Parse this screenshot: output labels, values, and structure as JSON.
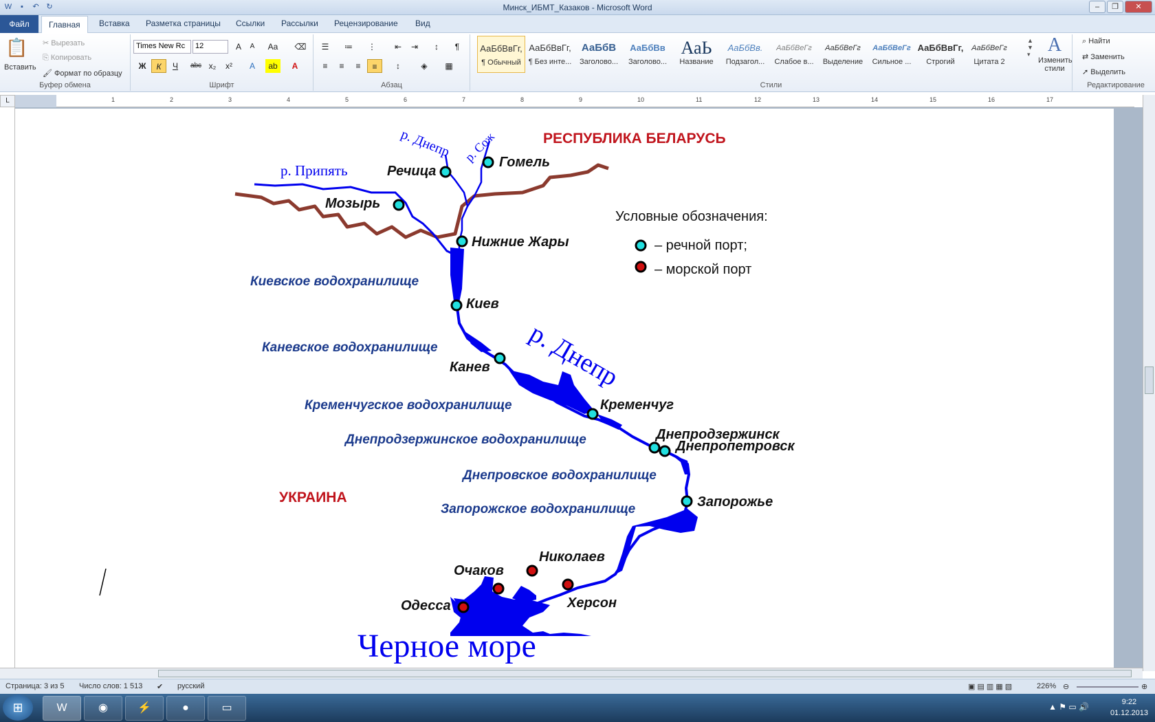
{
  "window": {
    "title": "Минск_ИБМТ_Казаков - Microsoft Word"
  },
  "tabs": [
    "Главная",
    "Вставка",
    "Разметка страницы",
    "Ссылки",
    "Рассылки",
    "Рецензирование",
    "Вид"
  ],
  "file_tab": "Файл",
  "clipboard": {
    "paste": "Вставить",
    "cut": "Вырезать",
    "copy": "Копировать",
    "format_painter": "Формат по образцу",
    "label": "Буфер обмена"
  },
  "font": {
    "name": "Times New Rc",
    "size": "12",
    "bold": "Ж",
    "italic": "К",
    "underline": "Ч",
    "strike": "abc",
    "sub": "x₂",
    "sup": "x²",
    "label": "Шрифт"
  },
  "paragraph": {
    "label": "Абзац"
  },
  "styles": {
    "label": "Стили",
    "items": [
      {
        "preview": "АаБбВвГг,",
        "name": "¶ Обычный"
      },
      {
        "preview": "АаБбВвГг,",
        "name": "¶ Без инте..."
      },
      {
        "preview": "АаБбВ",
        "name": "Заголово..."
      },
      {
        "preview": "АаБбВв",
        "name": "Заголово..."
      },
      {
        "preview": "АаЬ",
        "name": "Название"
      },
      {
        "preview": "АаБбВв.",
        "name": "Подзагол..."
      },
      {
        "preview": "АаБбВеГг",
        "name": "Слабое в..."
      },
      {
        "preview": "АаБбВеГг",
        "name": "Выделение"
      },
      {
        "preview": "АаБбВеГг",
        "name": "Сильное ..."
      },
      {
        "preview": "АаБбВвГг,",
        "name": "Строгий"
      },
      {
        "preview": "АаБбВеГг",
        "name": "Цитата 2"
      }
    ],
    "change_styles": "Изменить стили"
  },
  "editing": {
    "label": "Редактирование",
    "find": "Найти",
    "replace": "Заменить",
    "select": "Выделить"
  },
  "ruler": {
    "h": [
      "1",
      "2",
      "3",
      "4",
      "5",
      "6",
      "7",
      "8",
      "9",
      "10",
      "11",
      "12",
      "13",
      "14",
      "15",
      "16",
      "17"
    ]
  },
  "map": {
    "country_belarus": "РЕСПУБЛИКА БЕЛАРУСЬ",
    "country_ukraine": "УКРАИНА",
    "river_dnepr_top": "р. Днепр",
    "river_sozh": "р. Сож",
    "river_pripyat": "р. Припять",
    "river_dnepr_big": "р. Днепр",
    "sea": "Черное море",
    "legend_title": "Условные обозначения:",
    "legend_river": "– речной порт;",
    "legend_sea": "– морской порт",
    "river_ports": [
      "Речица",
      "Гомель",
      "Мозырь",
      "Нижние Жары",
      "Киев",
      "Канев",
      "Кременчуг",
      "Днепродзержинск",
      "Днепропетровск",
      "Запорожье"
    ],
    "sea_ports": [
      "Очаков",
      "Николаев",
      "Херсон",
      "Одесса"
    ],
    "reservoirs": [
      "Киевское водохранилище",
      "Каневское водохранилище",
      "Кременчугское водохранилище",
      "Днепродзержинское водохранилище",
      "Днепровское водохранилище",
      "Запорожское водохранилище"
    ],
    "colors": {
      "river": "#0000ee",
      "border": "#8b3a2e",
      "country": "#c0141c",
      "reservoir": "#1b3a8c",
      "river_port": "#22e0e0",
      "sea_port": "#d01010"
    }
  },
  "status": {
    "page": "Страница: 3 из 5",
    "words": "Число слов: 1 513",
    "lang": "русский",
    "zoom": "226%"
  },
  "clock": {
    "time": "9:22",
    "date": "01.12.2013"
  }
}
